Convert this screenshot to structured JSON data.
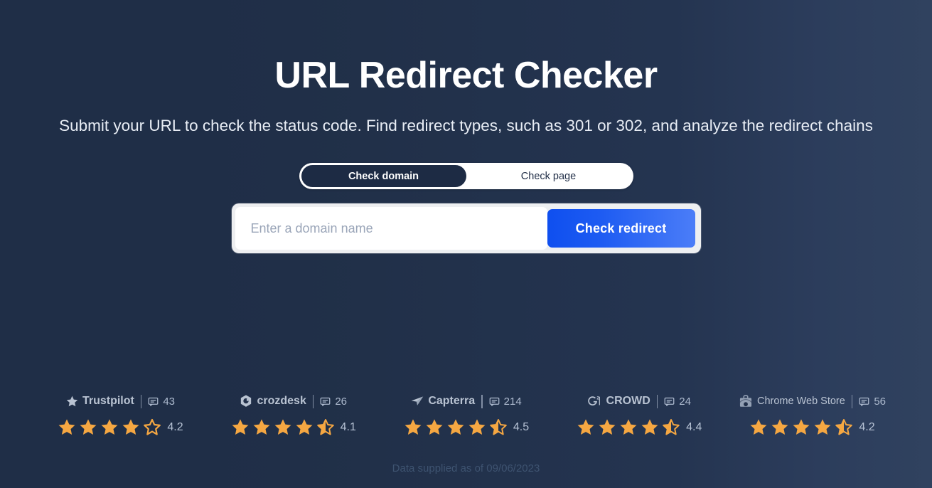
{
  "hero": {
    "title": "URL Redirect Checker",
    "subtitle": "Submit your URL to check the status code. Find redirect types, such as 301 or 302, and analyze the redirect chains"
  },
  "toggle": {
    "options": [
      {
        "label": "Check domain",
        "active": true
      },
      {
        "label": "Check page",
        "active": false
      }
    ]
  },
  "search": {
    "placeholder": "Enter a domain name",
    "value": "",
    "button_label": "Check redirect"
  },
  "ratings": [
    {
      "brand": "Trustpilot",
      "logo_icon": "trustpilot-star-icon",
      "reviews": "43",
      "rating": "4.2",
      "full_stars": 4,
      "half_star": false,
      "empty_stars": 1
    },
    {
      "brand": "crozdesk",
      "logo_icon": "crozdesk-icon",
      "reviews": "26",
      "rating": "4.1",
      "full_stars": 4,
      "half_star": true,
      "empty_stars": 0
    },
    {
      "brand": "Capterra",
      "logo_icon": "capterra-icon",
      "reviews": "214",
      "rating": "4.5",
      "full_stars": 4,
      "half_star": true,
      "empty_stars": 0
    },
    {
      "brand": "CROWD",
      "logo_icon": "g2-crowd-icon",
      "reviews": "24",
      "rating": "4.4",
      "full_stars": 4,
      "half_star": true,
      "empty_stars": 0
    },
    {
      "brand": "Chrome Web Store",
      "logo_icon": "chrome-web-store-icon",
      "reviews": "56",
      "rating": "4.2",
      "full_stars": 4,
      "half_star": true,
      "empty_stars": 0
    }
  ],
  "footnote": "Data supplied as of 09/06/2023",
  "colors": {
    "background": "#22304a",
    "accent_blue": "#1452f0",
    "star_orange": "#f5a742",
    "active_pill": "#1d2b44"
  }
}
